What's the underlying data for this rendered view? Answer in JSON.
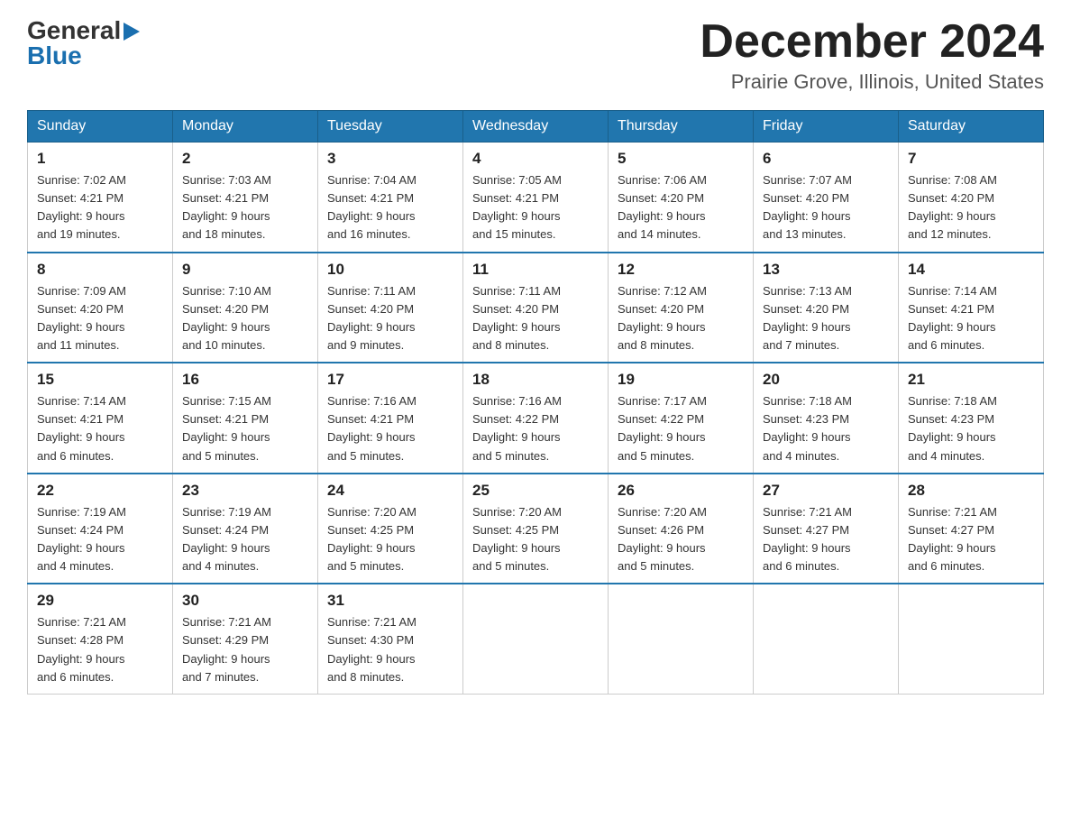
{
  "header": {
    "logo": {
      "general": "General",
      "blue": "Blue",
      "triangle": "▶"
    },
    "title": "December 2024",
    "location": "Prairie Grove, Illinois, United States"
  },
  "weekdays": [
    "Sunday",
    "Monday",
    "Tuesday",
    "Wednesday",
    "Thursday",
    "Friday",
    "Saturday"
  ],
  "weeks": [
    [
      {
        "day": "1",
        "sunrise": "7:02 AM",
        "sunset": "4:21 PM",
        "daylight": "9 hours and 19 minutes."
      },
      {
        "day": "2",
        "sunrise": "7:03 AM",
        "sunset": "4:21 PM",
        "daylight": "9 hours and 18 minutes."
      },
      {
        "day": "3",
        "sunrise": "7:04 AM",
        "sunset": "4:21 PM",
        "daylight": "9 hours and 16 minutes."
      },
      {
        "day": "4",
        "sunrise": "7:05 AM",
        "sunset": "4:21 PM",
        "daylight": "9 hours and 15 minutes."
      },
      {
        "day": "5",
        "sunrise": "7:06 AM",
        "sunset": "4:20 PM",
        "daylight": "9 hours and 14 minutes."
      },
      {
        "day": "6",
        "sunrise": "7:07 AM",
        "sunset": "4:20 PM",
        "daylight": "9 hours and 13 minutes."
      },
      {
        "day": "7",
        "sunrise": "7:08 AM",
        "sunset": "4:20 PM",
        "daylight": "9 hours and 12 minutes."
      }
    ],
    [
      {
        "day": "8",
        "sunrise": "7:09 AM",
        "sunset": "4:20 PM",
        "daylight": "9 hours and 11 minutes."
      },
      {
        "day": "9",
        "sunrise": "7:10 AM",
        "sunset": "4:20 PM",
        "daylight": "9 hours and 10 minutes."
      },
      {
        "day": "10",
        "sunrise": "7:11 AM",
        "sunset": "4:20 PM",
        "daylight": "9 hours and 9 minutes."
      },
      {
        "day": "11",
        "sunrise": "7:11 AM",
        "sunset": "4:20 PM",
        "daylight": "9 hours and 8 minutes."
      },
      {
        "day": "12",
        "sunrise": "7:12 AM",
        "sunset": "4:20 PM",
        "daylight": "9 hours and 8 minutes."
      },
      {
        "day": "13",
        "sunrise": "7:13 AM",
        "sunset": "4:20 PM",
        "daylight": "9 hours and 7 minutes."
      },
      {
        "day": "14",
        "sunrise": "7:14 AM",
        "sunset": "4:21 PM",
        "daylight": "9 hours and 6 minutes."
      }
    ],
    [
      {
        "day": "15",
        "sunrise": "7:14 AM",
        "sunset": "4:21 PM",
        "daylight": "9 hours and 6 minutes."
      },
      {
        "day": "16",
        "sunrise": "7:15 AM",
        "sunset": "4:21 PM",
        "daylight": "9 hours and 5 minutes."
      },
      {
        "day": "17",
        "sunrise": "7:16 AM",
        "sunset": "4:21 PM",
        "daylight": "9 hours and 5 minutes."
      },
      {
        "day": "18",
        "sunrise": "7:16 AM",
        "sunset": "4:22 PM",
        "daylight": "9 hours and 5 minutes."
      },
      {
        "day": "19",
        "sunrise": "7:17 AM",
        "sunset": "4:22 PM",
        "daylight": "9 hours and 5 minutes."
      },
      {
        "day": "20",
        "sunrise": "7:18 AM",
        "sunset": "4:23 PM",
        "daylight": "9 hours and 4 minutes."
      },
      {
        "day": "21",
        "sunrise": "7:18 AM",
        "sunset": "4:23 PM",
        "daylight": "9 hours and 4 minutes."
      }
    ],
    [
      {
        "day": "22",
        "sunrise": "7:19 AM",
        "sunset": "4:24 PM",
        "daylight": "9 hours and 4 minutes."
      },
      {
        "day": "23",
        "sunrise": "7:19 AM",
        "sunset": "4:24 PM",
        "daylight": "9 hours and 4 minutes."
      },
      {
        "day": "24",
        "sunrise": "7:20 AM",
        "sunset": "4:25 PM",
        "daylight": "9 hours and 5 minutes."
      },
      {
        "day": "25",
        "sunrise": "7:20 AM",
        "sunset": "4:25 PM",
        "daylight": "9 hours and 5 minutes."
      },
      {
        "day": "26",
        "sunrise": "7:20 AM",
        "sunset": "4:26 PM",
        "daylight": "9 hours and 5 minutes."
      },
      {
        "day": "27",
        "sunrise": "7:21 AM",
        "sunset": "4:27 PM",
        "daylight": "9 hours and 6 minutes."
      },
      {
        "day": "28",
        "sunrise": "7:21 AM",
        "sunset": "4:27 PM",
        "daylight": "9 hours and 6 minutes."
      }
    ],
    [
      {
        "day": "29",
        "sunrise": "7:21 AM",
        "sunset": "4:28 PM",
        "daylight": "9 hours and 6 minutes."
      },
      {
        "day": "30",
        "sunrise": "7:21 AM",
        "sunset": "4:29 PM",
        "daylight": "9 hours and 7 minutes."
      },
      {
        "day": "31",
        "sunrise": "7:21 AM",
        "sunset": "4:30 PM",
        "daylight": "9 hours and 8 minutes."
      },
      null,
      null,
      null,
      null
    ]
  ],
  "labels": {
    "sunrise": "Sunrise:",
    "sunset": "Sunset:",
    "daylight": "Daylight:"
  }
}
